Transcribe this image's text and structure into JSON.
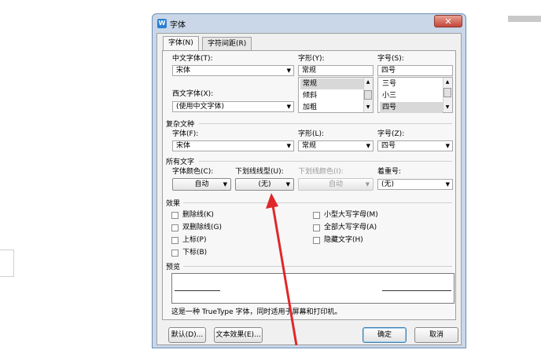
{
  "window": {
    "title": "字体",
    "close_label": "✕",
    "app_icon": "W"
  },
  "tabs": [
    {
      "label": "字体(N)",
      "active": true
    },
    {
      "label": "字符间距(R)",
      "active": false
    }
  ],
  "chinese_font": {
    "label": "中文字体(T):",
    "value": "宋体"
  },
  "style": {
    "label": "字形(Y):",
    "value": "常规",
    "options": [
      {
        "label": "常规",
        "selected": true
      },
      {
        "label": "倾斜",
        "selected": false
      },
      {
        "label": "加粗",
        "selected": false
      }
    ]
  },
  "size": {
    "label": "字号(S):",
    "value": "四号",
    "options": [
      {
        "label": "三号",
        "selected": false
      },
      {
        "label": "小三",
        "selected": false
      },
      {
        "label": "四号",
        "selected": true
      }
    ]
  },
  "western_font": {
    "label": "西文字体(X):",
    "value": "(使用中文字体)"
  },
  "complex": {
    "section_title": "复杂文种",
    "font": {
      "label": "字体(F):",
      "value": "宋体"
    },
    "style": {
      "label": "字形(L):",
      "value": "常规"
    },
    "size": {
      "label": "字号(Z):",
      "value": "四号"
    }
  },
  "all_text": {
    "section_title": "所有文字",
    "font_color": {
      "label": "字体颜色(C):",
      "value": "自动"
    },
    "underline_type": {
      "label": "下划线线型(U):",
      "value": "(无)"
    },
    "underline_color": {
      "label": "下划线颜色(I):",
      "value": "自动",
      "disabled": true
    },
    "emphasis": {
      "label": "着重号:",
      "value": "(无)"
    }
  },
  "effects": {
    "section_title": "效果",
    "left": [
      "删除线(K)",
      "双删除线(G)",
      "上标(P)",
      "下标(B)"
    ],
    "right": [
      "小型大写字母(M)",
      "全部大写字母(A)",
      "隐藏文字(H)"
    ]
  },
  "preview": {
    "section_title": "预览",
    "note": "这是一种 TrueType 字体，同时适用于屏幕和打印机。"
  },
  "buttons": {
    "default": "默认(D)...",
    "text_effects": "文本效果(E)...",
    "ok": "确定",
    "cancel": "取消"
  },
  "colors": {
    "window_frame": "#c9d7e8",
    "close": "#c4453a",
    "annotation_arrow": "#e0282a"
  }
}
